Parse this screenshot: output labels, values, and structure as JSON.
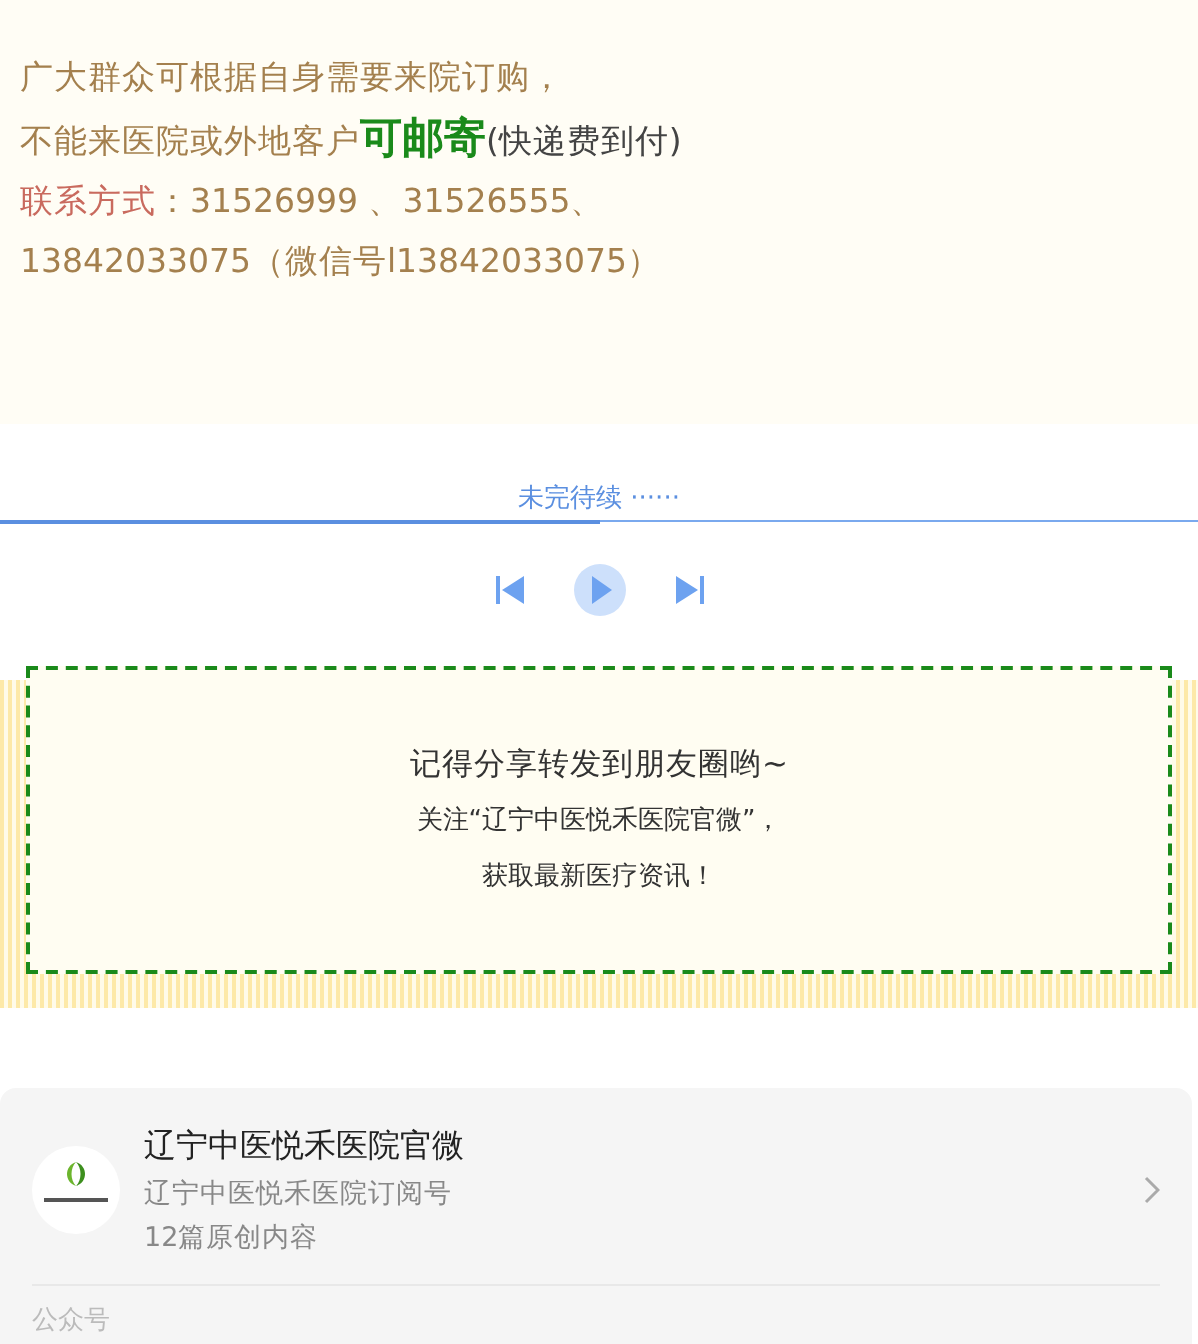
{
  "notice": {
    "lines": [
      [
        {
          "kind": "plain",
          "text": "广大群众可根据自身需要来院订购，"
        }
      ],
      [
        {
          "kind": "plain",
          "text": "不能来医院或外地客户"
        },
        {
          "kind": "highlight",
          "text": "可邮寄"
        },
        {
          "kind": "note",
          "text": "(快递费到付)"
        }
      ],
      [
        {
          "kind": "label",
          "text": "联系方式"
        },
        {
          "kind": "plain",
          "text": "：31526999 、31526555、"
        }
      ],
      [
        {
          "kind": "plain",
          "text": "13842033075（微信号l13842033075）"
        }
      ]
    ]
  },
  "player": {
    "caption": "未完待续 ······",
    "progress": {
      "level": 0.5
    }
  },
  "share_box": {
    "lines": [
      "记得分享转发到朋友圈哟~",
      "关注“辽宁中医悦禾医院官微”，",
      "获取最新医疗资讯！"
    ]
  },
  "account_card": {
    "name": "辽宁中医悦禾医院官微",
    "type": "辽宁中医悦禾医院订阅号",
    "originals": "12篇原创内容",
    "footer": "公众号"
  }
}
